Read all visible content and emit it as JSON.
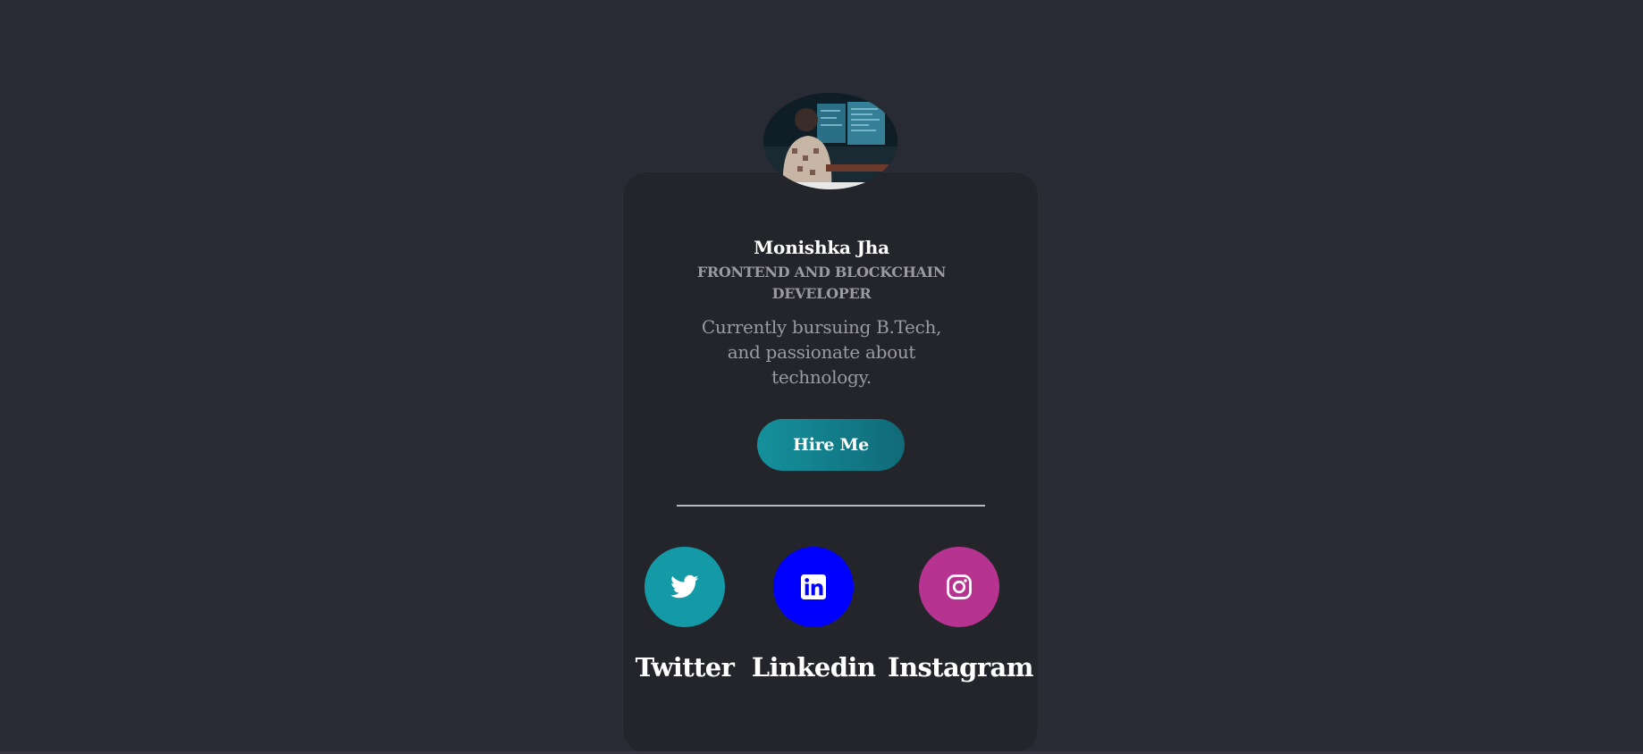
{
  "profile": {
    "name": "Monishka Jha",
    "role": "FRONTEND AND BLOCKCHAIN DEVELOPER",
    "bio": "Currently bursuing B.Tech, and passionate about technology.",
    "hire_label": "Hire Me"
  },
  "social": [
    {
      "label": "Twitter",
      "icon": "twitter-icon",
      "color": "#1499a6"
    },
    {
      "label": "Linkedin",
      "icon": "linkedin-icon",
      "color": "#0000ff"
    },
    {
      "label": "Instagram",
      "icon": "instagram-icon",
      "color": "#b6338f"
    }
  ],
  "theme": {
    "background": "#282b33",
    "card": "#24252b",
    "accent": "#14919c"
  }
}
